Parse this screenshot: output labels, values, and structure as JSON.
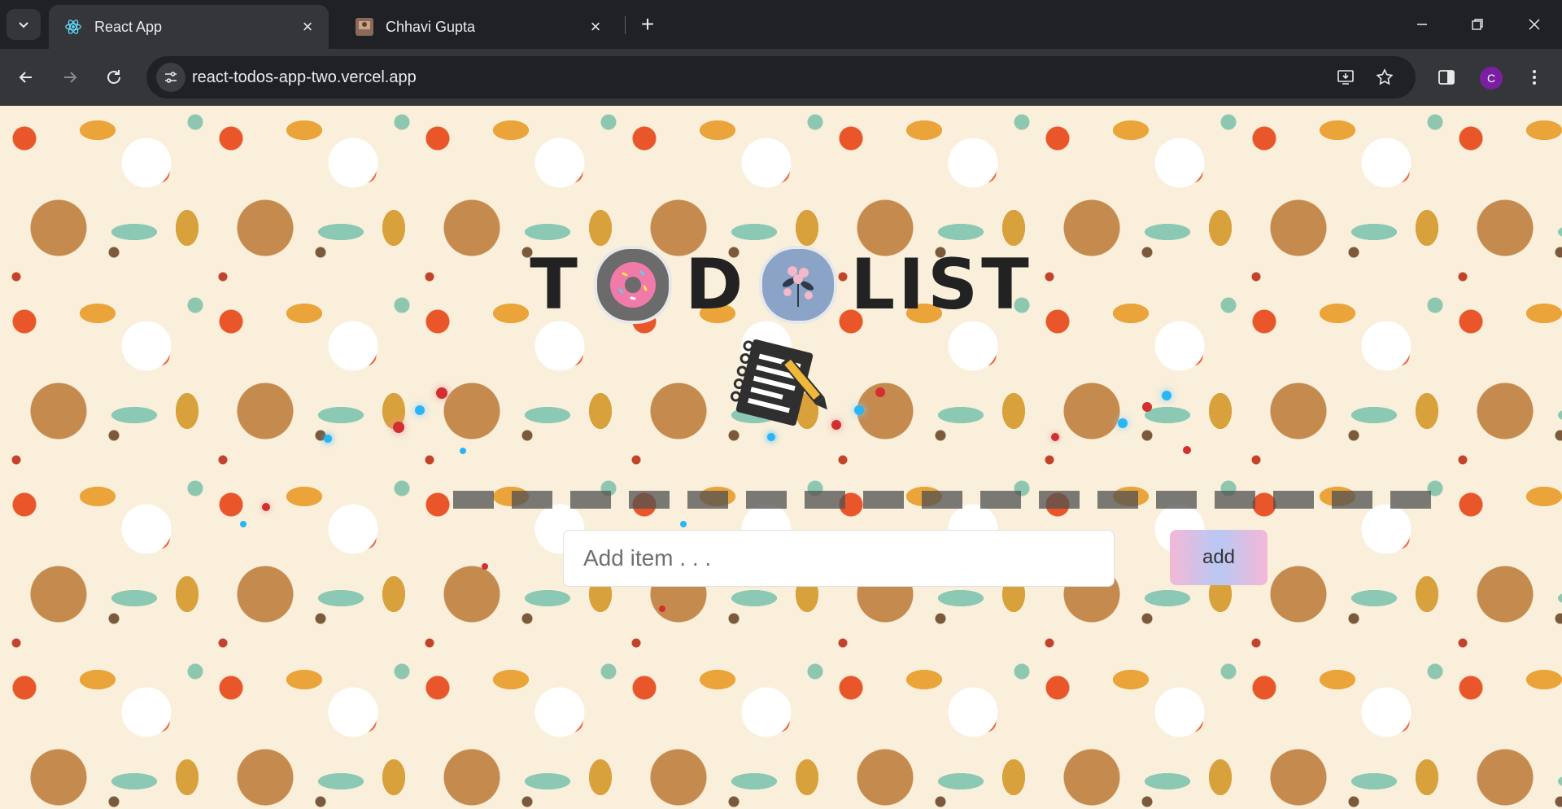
{
  "browser": {
    "tabs": [
      {
        "title": "React App",
        "favicon": "react-icon",
        "active": true
      },
      {
        "title": "Chhavi Gupta",
        "favicon": "site-thumbnail-icon",
        "active": false
      }
    ],
    "url": "react-todos-app-two.vercel.app",
    "profile_initial": "C",
    "profile_color": "#7b1fa2"
  },
  "app": {
    "heading_parts": [
      "T",
      "D",
      "LIST"
    ],
    "input_placeholder": "Add item . . .",
    "input_value": "",
    "add_button_label": "add"
  },
  "colors": {
    "background": "#f9efdb",
    "button_gradient": [
      "#f4b8d6",
      "#b8c8f4"
    ]
  }
}
